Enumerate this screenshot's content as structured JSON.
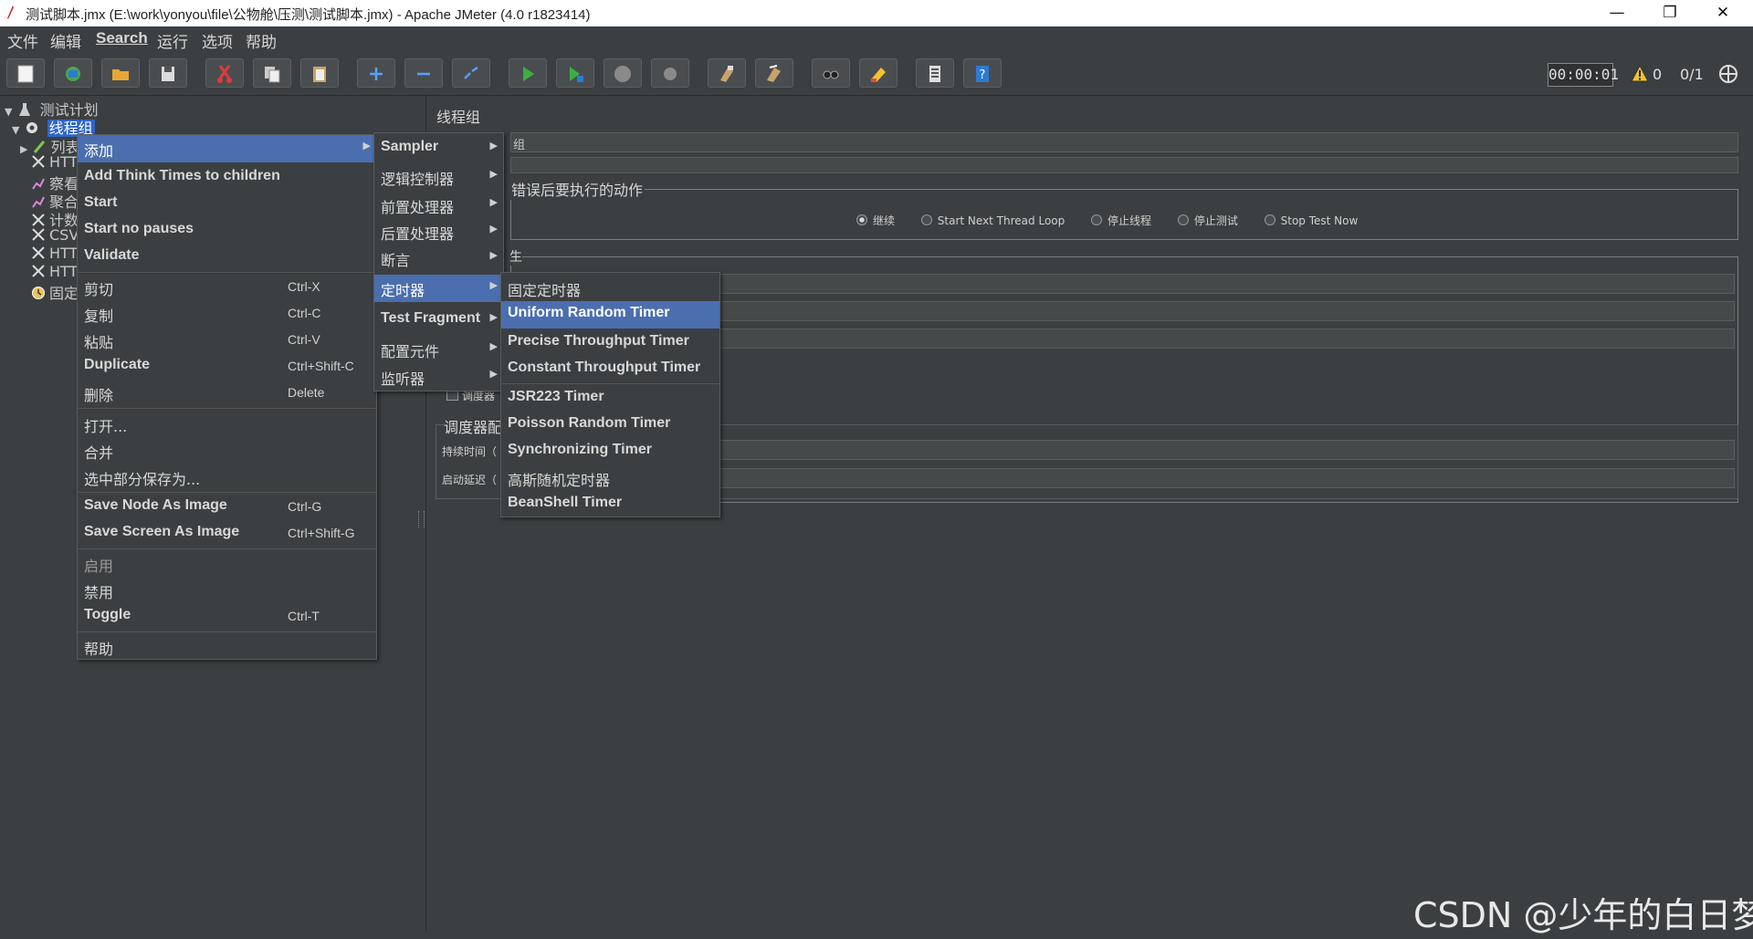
{
  "window": {
    "title": "测试脚本.jmx (E:\\work\\yonyou\\file\\公物舱\\压测\\测试脚本.jmx) - Apache JMeter (4.0 r1823414)",
    "minimize": "—",
    "restore": "❐",
    "close": "✕"
  },
  "menubar": [
    "文件",
    "编辑",
    "Search",
    "运行",
    "选项",
    "帮助"
  ],
  "toolbar": {
    "timer": "00:00:01",
    "warnings": "0",
    "threads": "0/1",
    "icons": [
      "new-icon",
      "templates-icon",
      "open-icon",
      "save-icon",
      "cut-icon",
      "copy-icon",
      "paste-icon",
      "expand-icon",
      "collapse-icon",
      "toggle-icon",
      "start-icon",
      "start-no-pause-icon",
      "stop-icon",
      "shutdown-icon",
      "clear-icon",
      "clear-all-icon",
      "search-icon",
      "reset-search-icon",
      "function-helper-icon",
      "help-icon"
    ]
  },
  "tree": {
    "items": [
      "测试计划",
      "线程组",
      "列表",
      "HTTP",
      "察看",
      "聚合",
      "计数",
      "CSV",
      "HTTP",
      "HTTP",
      "固定"
    ]
  },
  "panel": {
    "title": "线程组",
    "name_suffix": "组",
    "error_action_title": "错误后要执行的动作",
    "radios": [
      "继续",
      "Start Next Thread Loop",
      "停止线程",
      "停止测试",
      "Stop Test Now"
    ],
    "thread_props_suffix": "生",
    "scheduler_checkbox": "调度器",
    "scheduler_config": "调度器配",
    "duration_label": "持续时间（",
    "startup_delay_label": "启动延迟（"
  },
  "context_menu": {
    "items": [
      {
        "label": "添加",
        "submenu": true,
        "selected": true
      },
      {
        "label": "Add Think Times to children"
      },
      {
        "label": "Start"
      },
      {
        "label": "Start no pauses"
      },
      {
        "label": "Validate"
      },
      {
        "label": "剪切",
        "shortcut": "Ctrl-X"
      },
      {
        "label": "复制",
        "shortcut": "Ctrl-C"
      },
      {
        "label": "粘贴",
        "shortcut": "Ctrl-V"
      },
      {
        "label": "Duplicate",
        "shortcut": "Ctrl+Shift-C"
      },
      {
        "label": "删除",
        "shortcut": "Delete"
      },
      {
        "label": "打开..."
      },
      {
        "label": "合并"
      },
      {
        "label": "选中部分保存为..."
      },
      {
        "label": "Save Node As Image",
        "shortcut": "Ctrl-G"
      },
      {
        "label": "Save Screen As Image",
        "shortcut": "Ctrl+Shift-G"
      },
      {
        "label": "启用",
        "disabled": true
      },
      {
        "label": "禁用"
      },
      {
        "label": "Toggle",
        "shortcut": "Ctrl-T"
      },
      {
        "label": "帮助"
      }
    ]
  },
  "add_submenu": {
    "items": [
      "Sampler",
      "逻辑控制器",
      "前置处理器",
      "后置处理器",
      "断言",
      "定时器",
      "Test Fragment",
      "配置元件",
      "监听器"
    ],
    "selected": "定时器"
  },
  "timer_submenu": {
    "items": [
      "固定定时器",
      "Uniform Random Timer",
      "Precise Throughput Timer",
      "Constant Throughput Timer",
      "JSR223 Timer",
      "Poisson Random Timer",
      "Synchronizing Timer",
      "高斯随机定时器",
      "BeanShell Timer"
    ],
    "selected": "Uniform Random Timer"
  },
  "watermark": "CSDN @少年的白日梦",
  "colors": {
    "background": "#3c3f41",
    "selection": "#4b6eaf",
    "tree_selection": "#2f65ca"
  }
}
